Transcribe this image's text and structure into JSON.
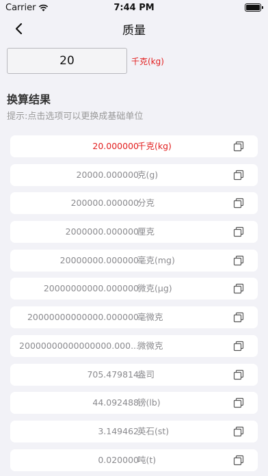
{
  "status": {
    "carrier": "Carrier",
    "time": "7:44 PM"
  },
  "nav": {
    "title": "质量",
    "back_icon": "chevron-left-icon"
  },
  "input": {
    "value": "20",
    "unit": "千克(kg)"
  },
  "results_title": "换算结果",
  "hint": "提示:点击选项可以更换成基础单位",
  "colors": {
    "accent": "#e21d1d",
    "muted": "#8a8a8e",
    "background": "#f2f2f7"
  },
  "results": [
    {
      "value": "20.000000",
      "unit": "千克(kg)",
      "active": true
    },
    {
      "value": "20000.000000",
      "unit": "克(g)"
    },
    {
      "value": "200000.000000",
      "unit": "分克"
    },
    {
      "value": "2000000.000000",
      "unit": "厘克"
    },
    {
      "value": "20000000.000000",
      "unit": "毫克(mg)"
    },
    {
      "value": "20000000000.000000",
      "unit": "微克(μg)"
    },
    {
      "value": "20000000000000.000000",
      "unit": "毫微克"
    },
    {
      "value": "20000000000000000.000...",
      "unit": "微微克"
    },
    {
      "value": "705.479814",
      "unit": "盎司"
    },
    {
      "value": "44.092488",
      "unit": "镑(lb)"
    },
    {
      "value": "3.149462",
      "unit": "英石(st)"
    },
    {
      "value": "0.020000",
      "unit": "吨(t)"
    }
  ]
}
